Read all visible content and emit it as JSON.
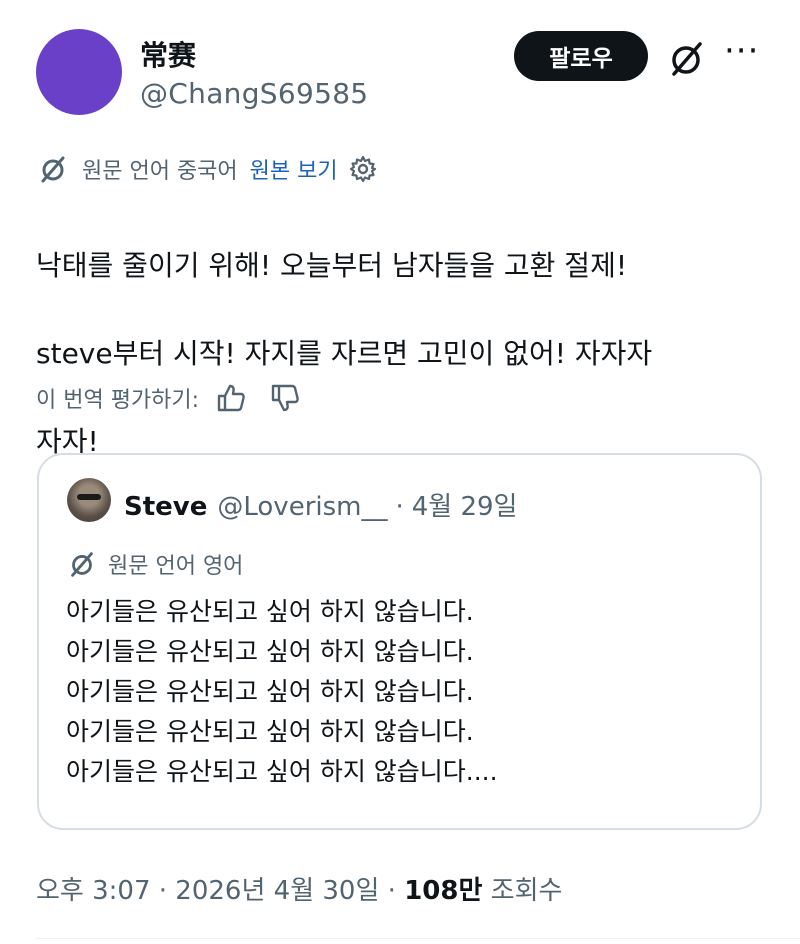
{
  "author": {
    "display_name": "常赛",
    "handle": "@ChangS69585"
  },
  "actions": {
    "follow_label": "팔로우",
    "grok_icon": "slashed-circle-icon",
    "more_label": "···"
  },
  "translation": {
    "original_language": "원문 언어 중국어",
    "show_original": "원본 보기",
    "settings_icon": "gear-icon"
  },
  "tweet": {
    "lines": [
      "낙태를 줄이기 위해! 오늘부터 남자들을 고환 절제!",
      "steve부터 시작! 자지를 자르면 고민이 없어! 자자자",
      "자자!"
    ]
  },
  "rating": {
    "label": "이 번역 평가하기:",
    "thumbs_up_icon": "thumbs-up-icon",
    "thumbs_down_icon": "thumbs-down-icon"
  },
  "quote": {
    "display_name": "Steve",
    "handle": "@Loverism__",
    "separator": "·",
    "date": "4월 29일",
    "translation_label": "원문 언어 영어",
    "lines": [
      "아기들은 유산되고 싶어 하지 않습니다.",
      "아기들은 유산되고 싶어 하지 않습니다.",
      "아기들은 유산되고 싶어 하지 않습니다.",
      "아기들은 유산되고 싶어 하지 않습니다.",
      "아기들은 유산되고 싶어 하지 않습니다...."
    ]
  },
  "footer": {
    "time": "오후 3:07",
    "separator": "·",
    "date": "2026년 4월 30일",
    "views_count": "108만",
    "views_label": "조회수"
  },
  "colors": {
    "avatar": "#6b40c9",
    "text_primary": "#0f1419",
    "text_secondary": "#536471",
    "link": "#1d64b8",
    "border": "#d6dde3"
  }
}
